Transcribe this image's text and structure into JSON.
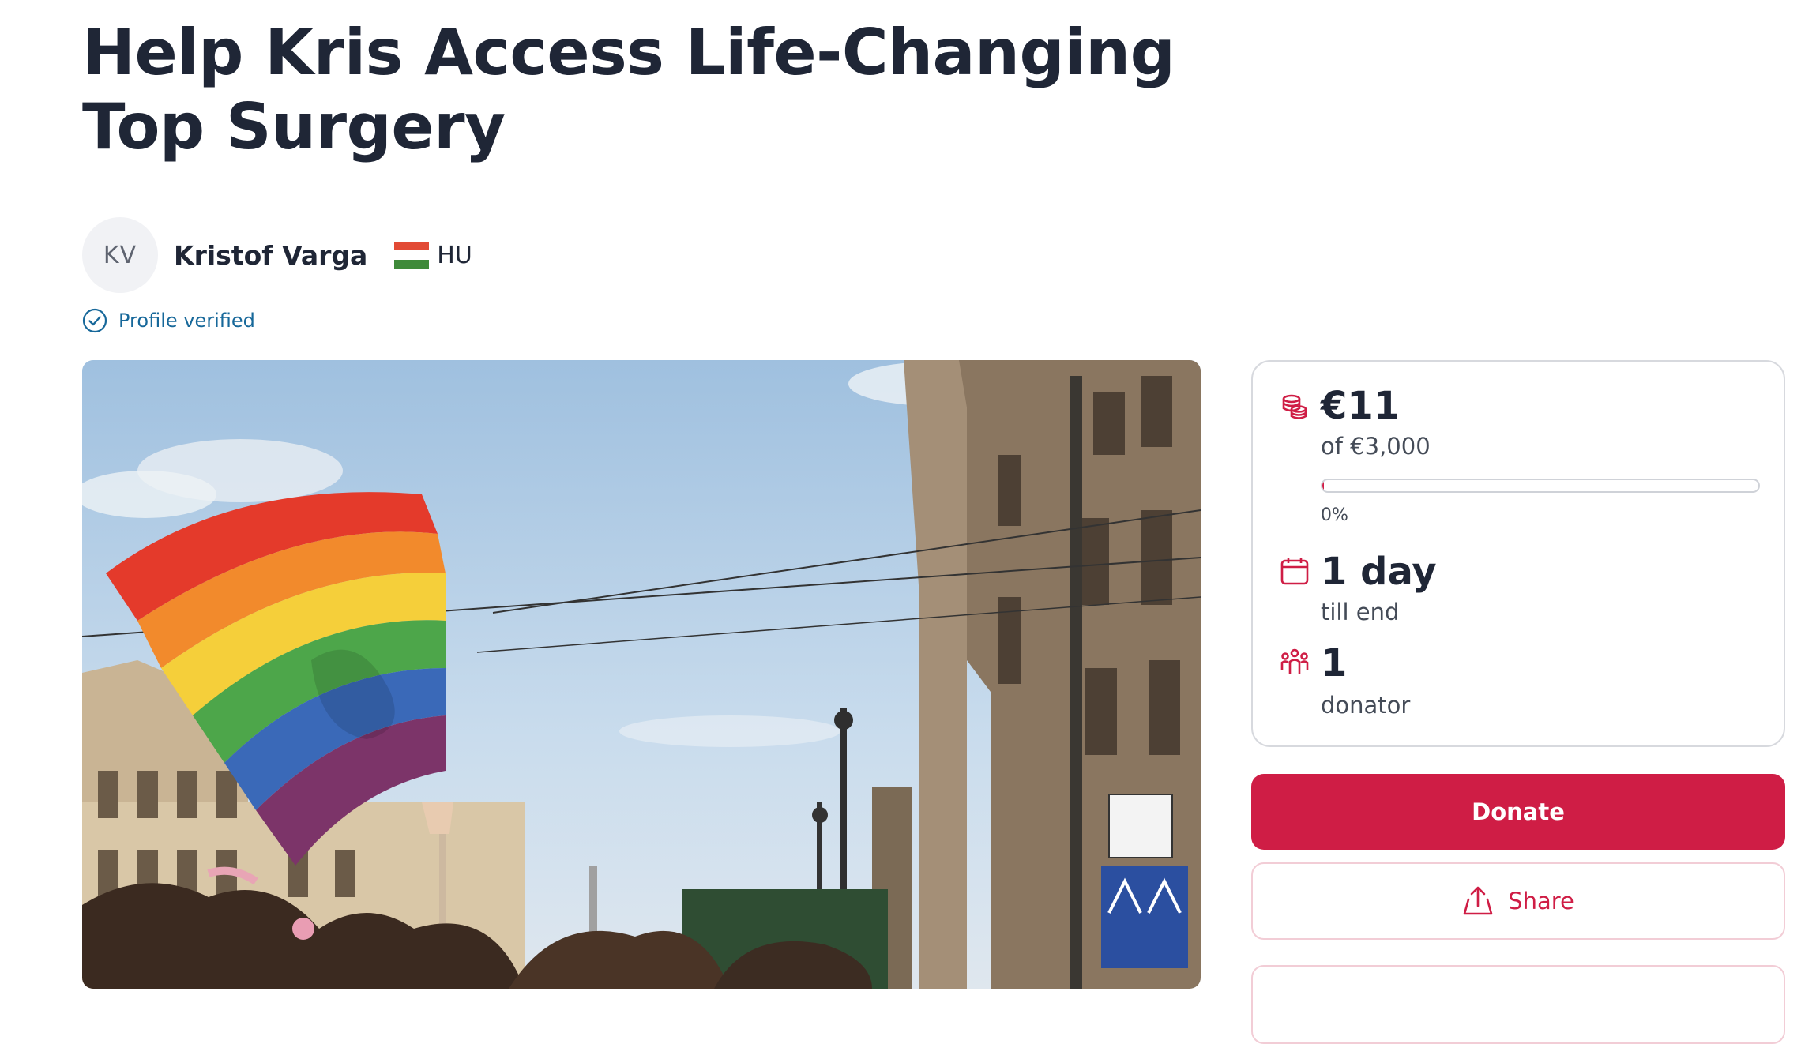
{
  "campaign": {
    "title": "Help Kris Access Life-Changing Top Surgery"
  },
  "author": {
    "initials": "KV",
    "name": "Kristof Varga",
    "country_code": "HU",
    "flag_colors": [
      "#e24a35",
      "#ffffff",
      "#3f8a3a"
    ],
    "verified_label": "Profile verified"
  },
  "hero_image": {
    "subject": "rainbow-pride-flag-over-street"
  },
  "stats": {
    "raised": "€11",
    "goal": "of €3,000",
    "progress_fraction": 0.004,
    "progress_label": "0%",
    "time_left": "1 day",
    "time_left_label": "till end",
    "donators": "1",
    "donators_label": "donator"
  },
  "actions": {
    "donate_label": "Donate",
    "share_label": "Share"
  },
  "colors": {
    "accent": "#cf1d45",
    "verified": "#17689a",
    "text": "#1f2636"
  }
}
